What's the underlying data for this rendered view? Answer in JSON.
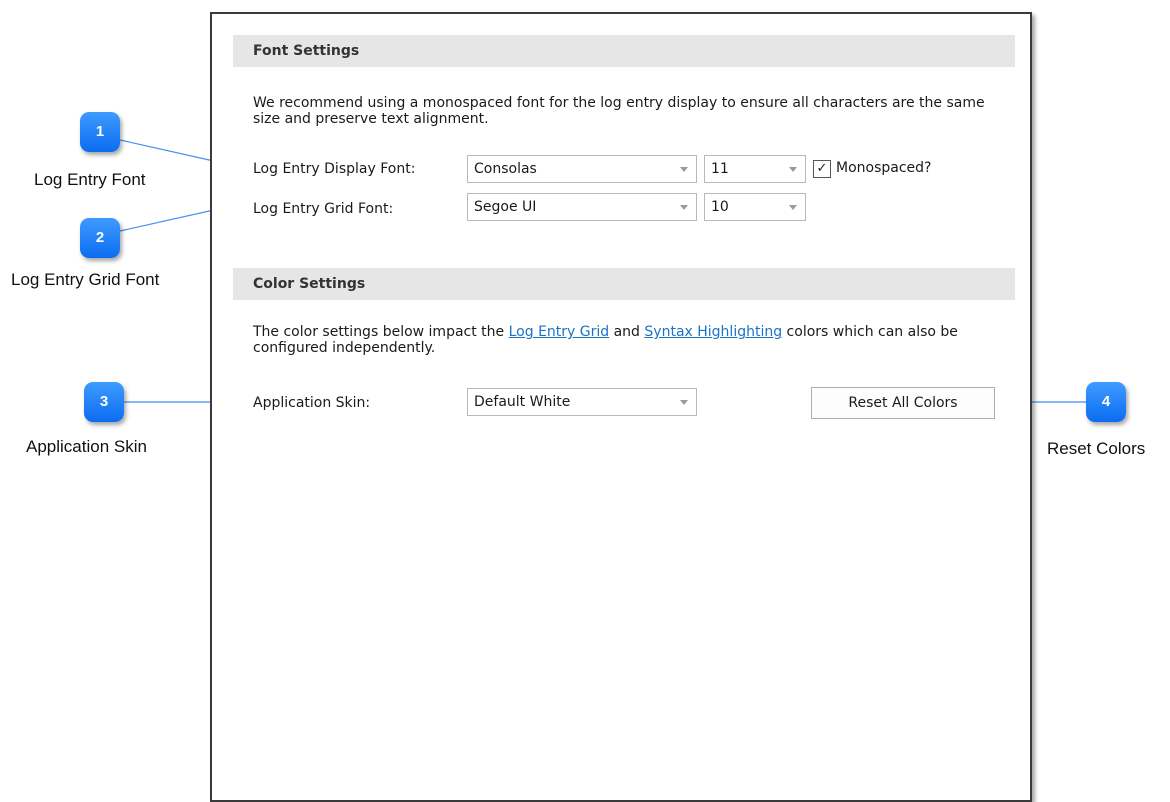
{
  "font_settings": {
    "header": "Font Settings",
    "description": "We recommend using a monospaced font for the log entry display to ensure all characters are the same size and preserve text alignment.",
    "display_font_label": "Log Entry Display Font:",
    "display_font_value": "Consolas",
    "display_size_value": "11",
    "monospaced_label": "Monospaced?",
    "monospaced_checked": "✓",
    "grid_font_label": "Log Entry Grid Font:",
    "grid_font_value": "Segoe UI",
    "grid_size_value": "10"
  },
  "color_settings": {
    "header": "Color Settings",
    "desc_prefix": "The color settings below impact the ",
    "link_grid": "Log Entry Grid",
    "desc_and": " and ",
    "link_syntax": "Syntax Highlighting",
    "desc_suffix": " colors which can also be configured independently.",
    "skin_label": "Application Skin:",
    "skin_value": "Default White",
    "reset_button": "Reset All Colors"
  },
  "callouts": [
    {
      "number": "1",
      "text": "Log Entry Font"
    },
    {
      "number": "2",
      "text": "Log Entry Grid Font"
    },
    {
      "number": "3",
      "text": "Application Skin"
    },
    {
      "number": "4",
      "text": "Reset Colors"
    }
  ],
  "colors": {
    "callout_blue": "#1a7fff",
    "link_blue": "#1a73c9",
    "header_bg": "#e6e6e6"
  }
}
